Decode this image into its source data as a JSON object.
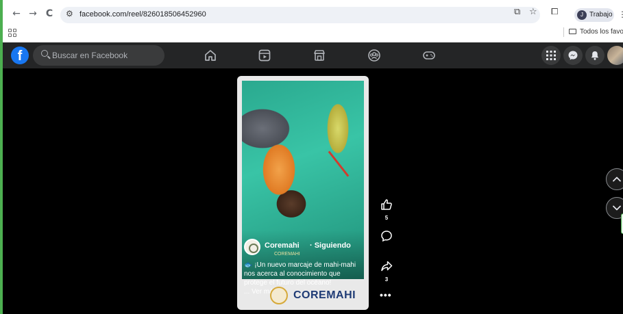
{
  "browser": {
    "back_icon": "←",
    "forward_icon": "→",
    "reload_icon": "C",
    "url": "facebook.com/reel/826018506452960",
    "profile_initial": "J",
    "profile_name": "Trabajo",
    "bookmarks_folder": "Todos los favoritos"
  },
  "facebook": {
    "search_placeholder": "Buscar en Facebook",
    "logo_letter": "f",
    "nav_icons": [
      "home-icon",
      "video-icon",
      "marketplace-icon",
      "groups-icon",
      "gaming-icon"
    ]
  },
  "reel": {
    "author": "Coremahi",
    "follow_status": "· Siguiendo",
    "author_sub": "COREMAHI",
    "caption": "🐟 ¡Un nuevo marcaje de mahi-mahi nos acerca al conocimiento que protege el futuro del océano!",
    "see_more": "... Ver más",
    "watermark": "COREMAHI",
    "likes": "5",
    "shares": "3"
  }
}
